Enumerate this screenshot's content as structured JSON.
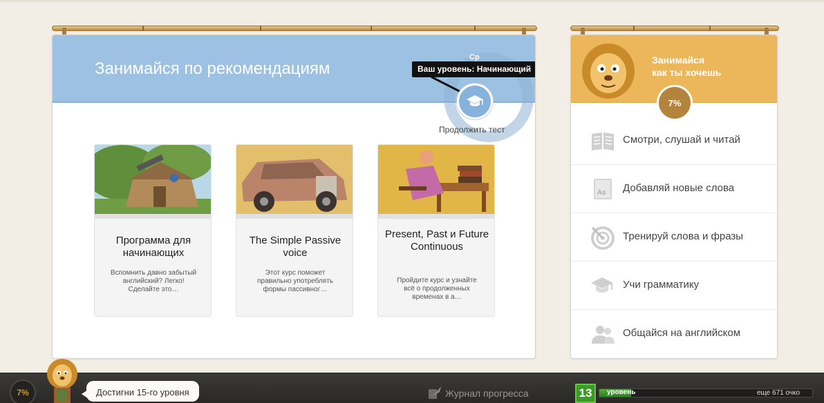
{
  "recommendations": {
    "title": "Занимайся по рекомендациям",
    "gauge_label": "Ср",
    "level_tooltip": "Ваш уровень: Начинающий",
    "continue_test": "Продолжить тест",
    "courses": [
      {
        "title": "Программа для начинающих",
        "description": "Вспомнить давно забытый английский? Легко! Сделайте это…"
      },
      {
        "title": "The Simple Passive voice",
        "description": "Этот курс поможет правильно употреблять формы пассивног…"
      },
      {
        "title": "Present, Past и Future Continuous",
        "description": "Пройдите курс и узнайте всё о продолженных временах в а…"
      }
    ]
  },
  "free_practice": {
    "title": "Занимайся как ты хочешь",
    "title_line1": "Занимайся",
    "title_line2": "как ты хочешь",
    "progress_label": "7%",
    "items": [
      {
        "label": "Смотри, слушай и читай",
        "icon": "book-icon"
      },
      {
        "label": "Добавляй новые слова",
        "icon": "dictionary-icon"
      },
      {
        "label": "Тренируй слова и фразы",
        "icon": "target-icon"
      },
      {
        "label": "Учи грамматику",
        "icon": "graduation-cap-icon"
      },
      {
        "label": "Общайся на английском",
        "icon": "people-icon"
      }
    ]
  },
  "bottom_bar": {
    "progress_label": "7%",
    "speech": "Достигни 15-го уровня",
    "journal": "Журнал прогресса",
    "level_number": "13",
    "level_word": "уровень",
    "level_progress": 0.15,
    "remaining": "еще 671 очко"
  }
}
